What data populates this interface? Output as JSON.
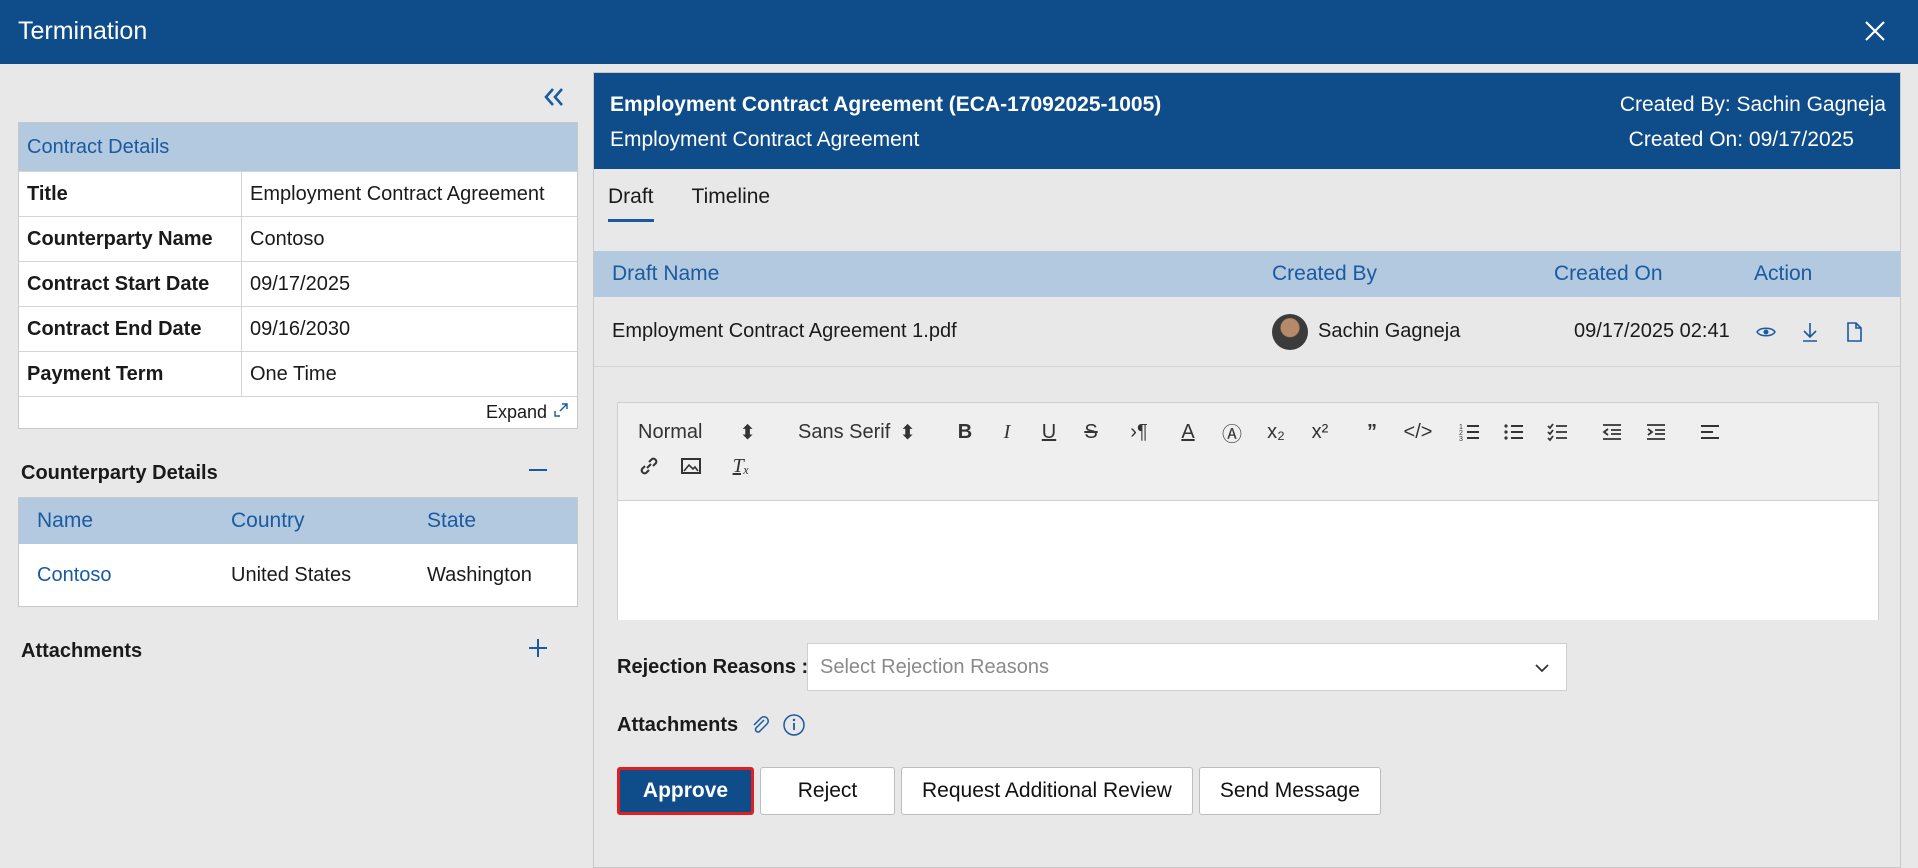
{
  "window": {
    "title": "Termination"
  },
  "contract_details": {
    "heading": "Contract Details",
    "rows": [
      {
        "label": "Title",
        "value": "Employment Contract Agreement"
      },
      {
        "label": "Counterparty Name",
        "value": "Contoso"
      },
      {
        "label": "Contract Start Date",
        "value": "09/17/2025"
      },
      {
        "label": "Contract End Date",
        "value": "09/16/2030"
      },
      {
        "label": "Payment Term",
        "value": "One Time"
      }
    ],
    "expand_label": "Expand"
  },
  "counterparty": {
    "heading": "Counterparty Details",
    "columns": [
      "Name",
      "Country",
      "State"
    ],
    "rows": [
      {
        "name": "Contoso",
        "country": "United States",
        "state": "Washington"
      }
    ]
  },
  "attachments_left": {
    "heading": "Attachments"
  },
  "detail": {
    "title": "Employment Contract Agreement (ECA-17092025-1005)",
    "subtitle": "Employment Contract Agreement",
    "created_by": "Created By: Sachin Gagneja",
    "created_on": "Created On: 09/17/2025"
  },
  "tabs": [
    {
      "label": "Draft",
      "active": true
    },
    {
      "label": "Timeline",
      "active": false
    }
  ],
  "drafts": {
    "columns": [
      "Draft Name",
      "Created By",
      "Created On",
      "Action"
    ],
    "rows": [
      {
        "name": "Employment Contract Agreement 1.pdf",
        "created_by": "Sachin Gagneja",
        "created_on": "09/17/2025 02:41"
      }
    ]
  },
  "editor": {
    "format_select": "Normal",
    "font_select": "Sans Serif",
    "icons": [
      "bold-icon",
      "italic-icon",
      "underline-icon",
      "strike-icon",
      "rtl-icon",
      "text-color-icon",
      "highlight-icon",
      "subscript-icon",
      "superscript-icon",
      "quote-icon",
      "code-icon",
      "ordered-list-icon",
      "bullet-list-icon",
      "check-list-icon",
      "outdent-icon",
      "indent-icon",
      "align-icon",
      "link-icon",
      "image-icon",
      "clear-format-icon"
    ]
  },
  "rejection": {
    "label": "Rejection Reasons :",
    "placeholder": "Select Rejection Reasons"
  },
  "attachments_right": {
    "label": "Attachments"
  },
  "actions": {
    "approve": "Approve",
    "reject": "Reject",
    "request_review": "Request Additional Review",
    "send_message": "Send Message"
  },
  "colors": {
    "brand": "#0f4c8a",
    "header_bg": "#b3c9df",
    "link": "#1a5aa0",
    "highlight": "#e02020"
  }
}
